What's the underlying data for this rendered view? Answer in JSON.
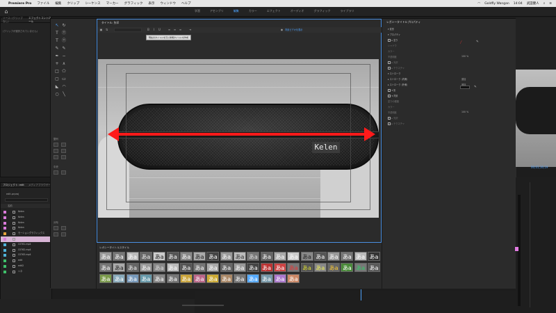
{
  "menubar": {
    "apple": "",
    "app_name": "Premiere Pro",
    "items": [
      "ファイル",
      "編集",
      "クリップ",
      "シーケンス",
      "マーカー",
      "グラフィック",
      "表示",
      "ウィンドウ",
      "ヘルプ"
    ],
    "status": [
      "Goldfly Wangan",
      "14:04",
      "武田健人"
    ]
  },
  "workspaces": [
    "学習",
    "アセンブリ",
    "編集",
    "カラー",
    "エフェクト",
    "オーディオ",
    "グラフィック",
    "ライブラリ"
  ],
  "active_workspace": "編集",
  "source_panel": {
    "tabs": [
      "ソース: (クリップなし)",
      "エフェクトコントロール"
    ],
    "empty_text": "(クリップが選択されていません)"
  },
  "project_panel": {
    "tabs": [
      "プロジェクト: edit",
      "メディアブラウザー"
    ],
    "project_name": "edit.prproj",
    "name_header": "名前",
    "rows": [
      {
        "label": "Kelen",
        "color": "#d97ad9"
      },
      {
        "label": "Kelen",
        "color": "#d97ad9"
      },
      {
        "label": "Kelen",
        "color": "#d97ad9"
      },
      {
        "label": "Kelen",
        "color": "#d97ad9"
      },
      {
        "label": "モーショングラフィックス",
        "color": "#e5a33a"
      },
      {
        "label": "",
        "color": "#d97ad9"
      },
      {
        "label": "C0761.mp4",
        "color": "#4fb3d9"
      },
      {
        "label": "C0762.mp4",
        "color": "#4fb3d9"
      },
      {
        "label": "C0763.mp4",
        "color": "#4fb3d9"
      },
      {
        "label": "edit",
        "color": "#3fbf6a"
      },
      {
        "label": "edit2",
        "color": "#3fbf6a"
      },
      {
        "label": "シネ",
        "color": "#3fbf6a"
      }
    ]
  },
  "title_dialog": {
    "header": "タイトル: 矢印",
    "tooltip": "現在のタイトルを元に新規タイトルを作成",
    "toolbar_status": "背景ビデオを表示",
    "canvas_label": "Kelen",
    "tools": [
      "selection-tool",
      "rotate-tool",
      "type-tool",
      "vertical-type-tool",
      "area-type-tool",
      "vertical-area-type-tool",
      "path-type-tool",
      "vertical-path-type-tool",
      "pen-tool",
      "delete-anchor-tool",
      "add-anchor-tool",
      "convert-anchor-tool",
      "rectangle-tool",
      "clipped-corner-tool",
      "rounded-corner-tool",
      "rounded-rect-tool",
      "wedge-tool",
      "arc-tool",
      "ellipse-tool",
      "line-tool"
    ],
    "tool_glyphs": [
      "↖",
      "↻",
      "T",
      "Ⓣ",
      "T",
      "Ⓣ",
      "✎",
      "✎",
      "✒",
      "−",
      "+",
      "∧",
      "□",
      "⬠",
      "▢",
      "▭",
      "◣",
      "◠",
      "○",
      "╲"
    ],
    "align_label": "整列",
    "center_label": "中央",
    "distribute_label": "分布",
    "styles_label": "レガシータイトルスタイル",
    "style_glyph": "あa"
  },
  "properties": {
    "title": "レガシータイトルプロパティ",
    "rows": [
      {
        "label": "▾ 変形",
        "dim": false
      },
      {
        "label": "▾ プロパティ",
        "dim": false
      },
      {
        "label": "▸ 塗り",
        "dim": false,
        "checkbox": true
      },
      {
        "label": "シャドウ",
        "dim": true
      },
      {
        "label": "カラー",
        "dim": true
      },
      {
        "label": "不透明度",
        "dim": true,
        "value": "100 %"
      },
      {
        "label": "▸ 光沢",
        "dim": true,
        "checkbox": true
      },
      {
        "label": "▸ テクスチャ",
        "dim": true,
        "checkbox": true
      },
      {
        "label": "▾ ストローク",
        "dim": false
      },
      {
        "label": "▸ ストローク (内側)",
        "dim": false,
        "value": "追加"
      },
      {
        "label": "▸ ストローク (外側)",
        "dim": false,
        "value": "追加"
      },
      {
        "label": "▾ 影",
        "dim": false,
        "checkbox": true
      },
      {
        "label": "▾ 背景",
        "dim": false,
        "checkbox": true
      },
      {
        "label": "塗りの種類",
        "dim": true
      },
      {
        "label": "カラー",
        "dim": true
      },
      {
        "label": "不透明度",
        "dim": true,
        "value": "100 %"
      },
      {
        "label": "▸ 光沢",
        "dim": true,
        "checkbox": true
      },
      {
        "label": "▸ テクスチャ",
        "dim": true,
        "checkbox": true
      }
    ]
  },
  "program": {
    "timecode": "00;01;16;19"
  },
  "colors": {
    "accent": "#4ea3ff",
    "arrow": "#ff1a1a",
    "selected_row": "#d7b5d5"
  }
}
